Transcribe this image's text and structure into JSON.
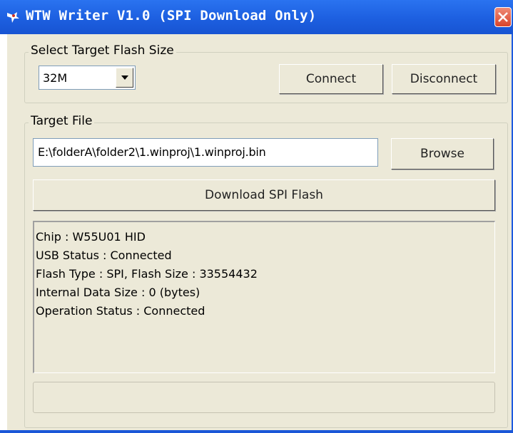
{
  "window": {
    "title": "WTW Writer V1.0 (SPI Download Only)"
  },
  "flash_size_group": {
    "label": "Select Target Flash Size",
    "selected": "32M",
    "connect_label": "Connect",
    "disconnect_label": "Disconnect"
  },
  "target_file_group": {
    "label": "Target File",
    "path": "E:\\folderA\\folder2\\1.winproj\\1.winproj.bin",
    "browse_label": "Browse"
  },
  "download_button": {
    "label": "Download SPI Flash"
  },
  "status_log": [
    "Chip : W55U01 HID",
    "USB Status : Connected",
    "Flash Type : SPI, Flash Size : 33554432",
    "Internal Data Size : 0 (bytes)",
    "Operation Status : Connected"
  ],
  "colors": {
    "titlebar": "#1d5fe0",
    "client_background": "#ece9d8",
    "close_button": "#d8442b"
  }
}
